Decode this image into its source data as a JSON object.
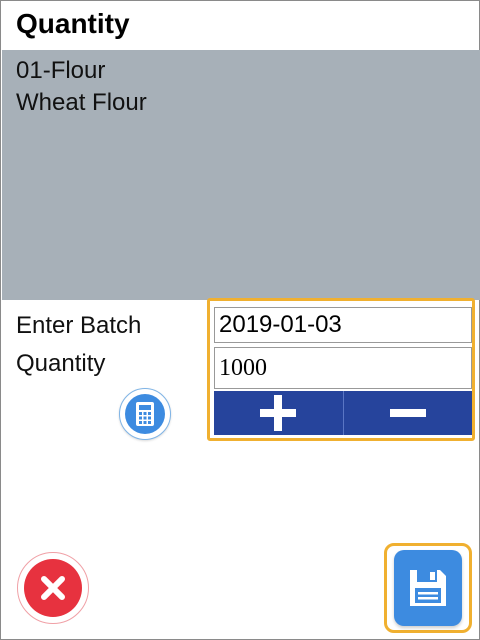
{
  "header": {
    "title": "Quantity"
  },
  "item": {
    "code_line": "01-Flour",
    "name_line": "Wheat Flour"
  },
  "form": {
    "label": "Enter Batch Quantity",
    "date_value": "2019-01-03",
    "quantity_value": "1000"
  },
  "icons": {
    "calculator": "calculator-icon",
    "plus": "plus-icon",
    "minus": "minus-icon",
    "cancel": "close-icon",
    "save": "floppy-disk-icon"
  },
  "colors": {
    "panel_bg": "#a7b0b8",
    "focus_outline": "#f0b030",
    "stepper_bg": "#26449c",
    "accent_blue": "#3d8be0",
    "cancel_red": "#e7323f"
  }
}
